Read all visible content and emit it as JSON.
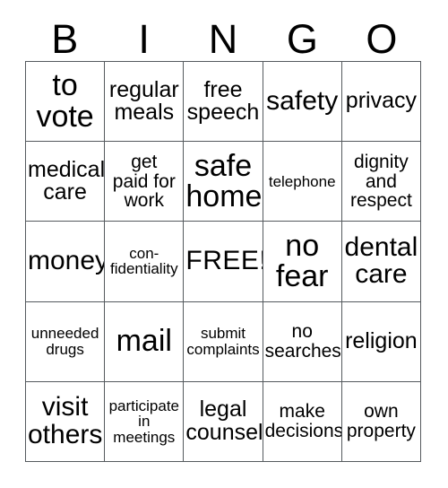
{
  "card": {
    "title": "BINGO",
    "header_letters": [
      "B",
      "I",
      "N",
      "G",
      "O"
    ],
    "free_space_label": "FREE!",
    "free_space_index": {
      "row": 2,
      "col": 2
    },
    "grid_columns": 5,
    "grid_rows": 5,
    "colors": {
      "background": "#ffffff",
      "text": "#000000",
      "grid_line": "#555a5e"
    },
    "cells": [
      [
        {
          "text": "to\nvote",
          "size": "xl"
        },
        {
          "text": "regular\nmeals",
          "size": "md"
        },
        {
          "text": "free\nspeech",
          "size": "md"
        },
        {
          "text": "safety",
          "size": "lg"
        },
        {
          "text": "privacy",
          "size": "md"
        }
      ],
      [
        {
          "text": "medical\ncare",
          "size": "md"
        },
        {
          "text": "get\npaid for\nwork",
          "size": "sm"
        },
        {
          "text": "safe\nhome",
          "size": "xl"
        },
        {
          "text": "telephone",
          "size": "xs"
        },
        {
          "text": "dignity\nand\nrespect",
          "size": "sm"
        }
      ],
      [
        {
          "text": "money",
          "size": "lg"
        },
        {
          "text": "con-\nfidentiality",
          "size": "xs"
        },
        {
          "text": "FREE!",
          "size": "free"
        },
        {
          "text": "no\nfear",
          "size": "xl"
        },
        {
          "text": "dental\ncare",
          "size": "lg"
        }
      ],
      [
        {
          "text": "unneeded\ndrugs",
          "size": "xs"
        },
        {
          "text": "mail",
          "size": "xl"
        },
        {
          "text": "submit\ncomplaints",
          "size": "xs"
        },
        {
          "text": "no\nsearches",
          "size": "sm"
        },
        {
          "text": "religion",
          "size": "md"
        }
      ],
      [
        {
          "text": "visit\nothers",
          "size": "lg"
        },
        {
          "text": "participate\nin\nmeetings",
          "size": "xs"
        },
        {
          "text": "legal\ncounsel",
          "size": "md"
        },
        {
          "text": "make\ndecisions",
          "size": "sm"
        },
        {
          "text": "own\nproperty",
          "size": "sm"
        }
      ]
    ]
  }
}
